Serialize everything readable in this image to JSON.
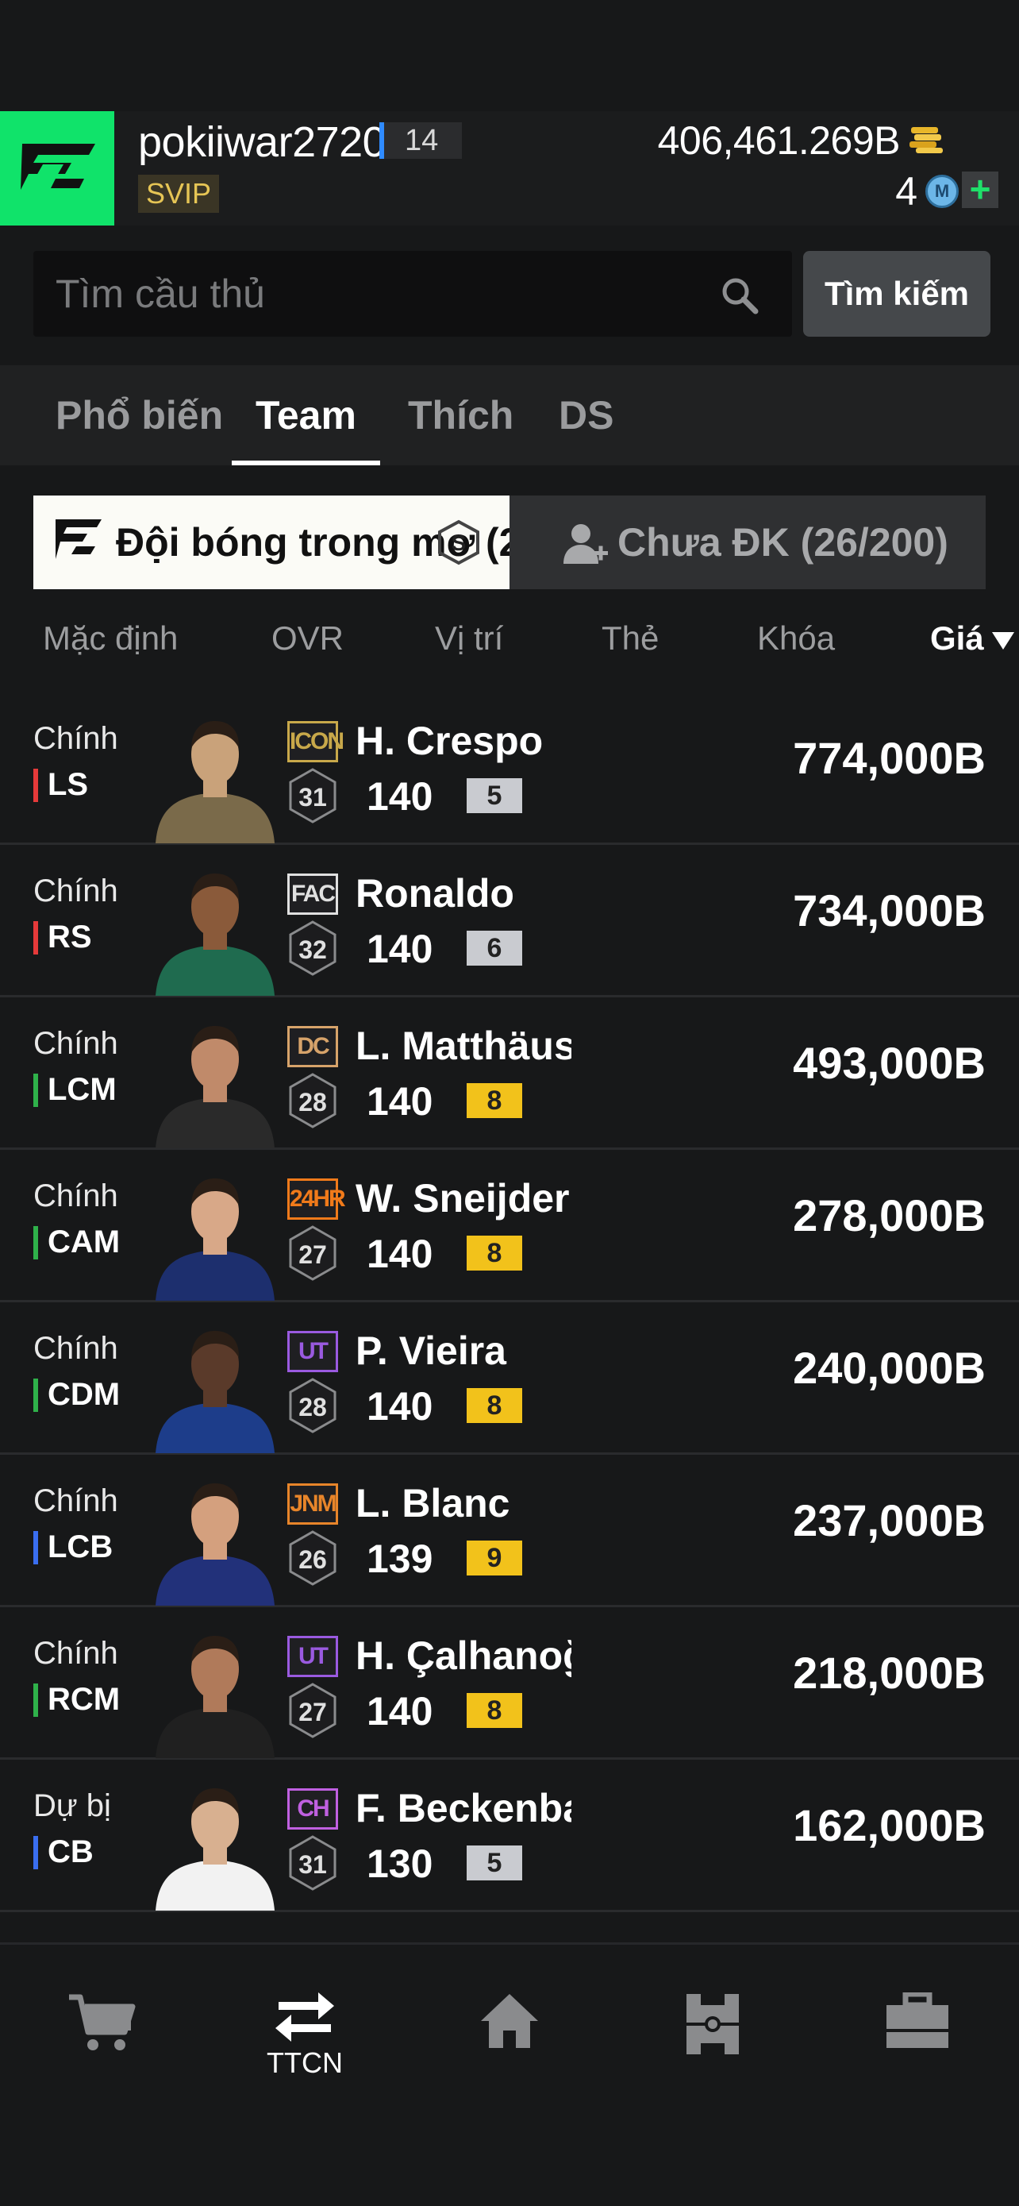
{
  "header": {
    "username": "pokiiwar2720",
    "level": "14",
    "vip": "SVIP",
    "coins": "406,461.269B",
    "m_points": "4",
    "m_icon_letter": "M",
    "plus": "+"
  },
  "search": {
    "placeholder": "Tìm cầu thủ",
    "button_label": "Tìm kiếm"
  },
  "tabs": [
    {
      "label": "Phổ biến",
      "active": false
    },
    {
      "label": "Team",
      "active": true
    },
    {
      "label": "Thích",
      "active": false
    },
    {
      "label": "DS",
      "active": false
    }
  ],
  "team_filter": {
    "selected_label": "Đội bóng trong mơ",
    "badge": "S",
    "suffix": "(2",
    "unregistered_label": "Chưa ĐK (26/200)"
  },
  "sort_columns": [
    {
      "label": "Mặc định",
      "active": false
    },
    {
      "label": "OVR",
      "active": false
    },
    {
      "label": "Vị trí",
      "active": false
    },
    {
      "label": "Thẻ",
      "active": false
    },
    {
      "label": "Khóa",
      "active": false
    },
    {
      "label": "Giá",
      "active": true
    }
  ],
  "players": [
    {
      "role": "Chính",
      "position": "LS",
      "pos_color": "#e53a3a",
      "season": "ICON",
      "season_color": "#c8a84a",
      "grade": "31",
      "name": "H. Crespo",
      "ovr": "140",
      "upgrade": "5",
      "upgrade_color": "#c9cbd0",
      "price": "774,000B"
    },
    {
      "role": "Chính",
      "position": "RS",
      "pos_color": "#e53a3a",
      "season": "FAC",
      "season_color": "#e0e0e0",
      "grade": "32",
      "name": "Ronaldo",
      "ovr": "140",
      "upgrade": "6",
      "upgrade_color": "#c9cbd0",
      "price": "734,000B"
    },
    {
      "role": "Chính",
      "position": "LCM",
      "pos_color": "#2fb14a",
      "season": "DC",
      "season_color": "#d7a36a",
      "grade": "28",
      "name": "L. Matthäus",
      "ovr": "140",
      "upgrade": "8",
      "upgrade_color": "#f2c21b",
      "price": "493,000B"
    },
    {
      "role": "Chính",
      "position": "CAM",
      "pos_color": "#2fb14a",
      "season": "24HR",
      "season_color": "#f07a1a",
      "grade": "27",
      "name": "W. Sneijder",
      "ovr": "140",
      "upgrade": "8",
      "upgrade_color": "#f2c21b",
      "price": "278,000B"
    },
    {
      "role": "Chính",
      "position": "CDM",
      "pos_color": "#2fb14a",
      "season": "UT",
      "season_color": "#9a5ae0",
      "grade": "28",
      "name": "P. Vieira",
      "ovr": "140",
      "upgrade": "8",
      "upgrade_color": "#f2c21b",
      "price": "240,000B"
    },
    {
      "role": "Chính",
      "position": "LCB",
      "pos_color": "#3a6ef0",
      "season": "JNM",
      "season_color": "#e8852a",
      "grade": "26",
      "name": "L. Blanc",
      "ovr": "139",
      "upgrade": "9",
      "upgrade_color": "#f2c21b",
      "price": "237,000B"
    },
    {
      "role": "Chính",
      "position": "RCM",
      "pos_color": "#2fb14a",
      "season": "UT",
      "season_color": "#9a5ae0",
      "grade": "27",
      "name": "H. Çalhanoğlu",
      "ovr": "140",
      "upgrade": "8",
      "upgrade_color": "#f2c21b",
      "price": "218,000B"
    },
    {
      "role": "Dự bị",
      "position": "CB",
      "pos_color": "#3a6ef0",
      "season": "CH",
      "season_color": "#c060e0",
      "grade": "31",
      "name": "F. Beckenbauer",
      "ovr": "130",
      "upgrade": "5",
      "upgrade_color": "#c9cbd0",
      "price": "162,000B"
    }
  ],
  "bottom_nav": [
    {
      "icon": "cart-icon",
      "label": ""
    },
    {
      "icon": "transfer-icon",
      "label": "TTCN"
    },
    {
      "icon": "home-icon",
      "label": ""
    },
    {
      "icon": "formation-icon",
      "label": ""
    },
    {
      "icon": "briefcase-icon",
      "label": ""
    }
  ]
}
